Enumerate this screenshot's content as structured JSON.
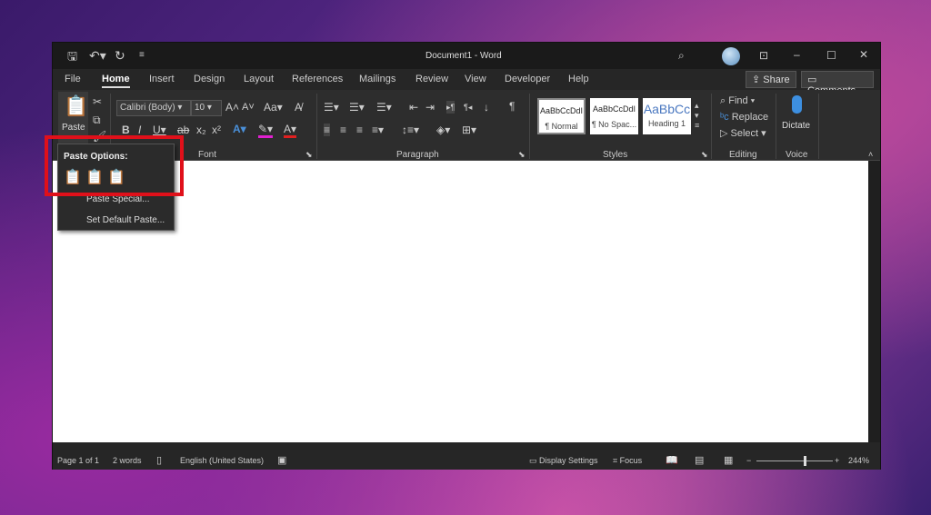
{
  "window": {
    "title": "Document1  -  Word"
  },
  "titlebar": {
    "icons": [
      "save-icon",
      "undo-icon",
      "redo-icon",
      "customize-icon",
      "search-icon",
      "avatar",
      "ribbon-display-icon",
      "minimize-icon",
      "maximize-icon",
      "close-icon"
    ]
  },
  "tabs": [
    "File",
    "Home",
    "Insert",
    "Design",
    "Layout",
    "References",
    "Mailings",
    "Review",
    "View",
    "Developer",
    "Help"
  ],
  "share_label": "Share",
  "comments_label": "Comments",
  "ribbon": {
    "paste_label": "Paste",
    "font_name": "Calibri (Body)",
    "font_size": "10",
    "groups": {
      "font": "Font",
      "paragraph": "Paragraph",
      "styles": "Styles",
      "editing": "Editing",
      "voice": "Voice"
    },
    "styles": [
      {
        "preview": "AaBbCcDdI",
        "name": "¶ Normal"
      },
      {
        "preview": "AaBbCcDdI",
        "name": "¶ No Spac..."
      },
      {
        "preview": "AaBbCc",
        "name": "Heading 1"
      }
    ],
    "editing": {
      "find": "Find",
      "replace": "Replace",
      "select": "Select"
    },
    "dictate": "Dictate",
    "change_case": "Aa",
    "colors": {
      "highlight": "#e020d0",
      "font_color": "#e02020",
      "accent": "#4a90d9"
    }
  },
  "paste_menu": {
    "title": "Paste Options:",
    "paste_special": "Paste Special...",
    "set_default": "Set Default Paste...",
    "options": [
      "keep-source-formatting-icon",
      "merge-formatting-icon",
      "keep-text-only-icon"
    ]
  },
  "status": {
    "page": "Page 1 of 1",
    "words": "2 words",
    "language": "English (United States)",
    "display_settings": "Display Settings",
    "focus": "Focus",
    "zoom": "244%"
  },
  "zoom_level_percent": 244
}
